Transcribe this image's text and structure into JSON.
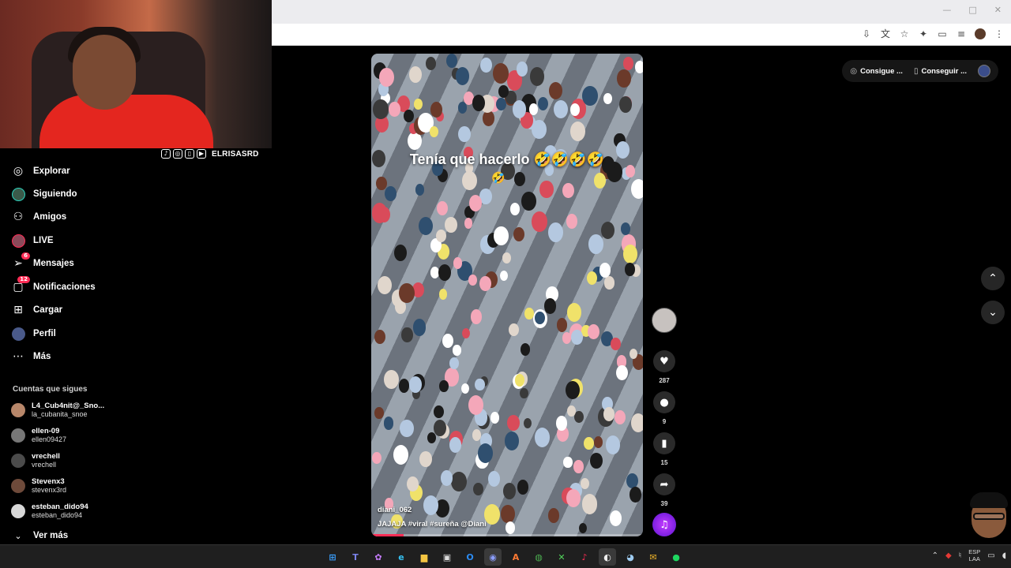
{
  "browser": {
    "window_controls": [
      "—",
      "□",
      "✕"
    ],
    "addr_icons": [
      "download-icon",
      "translate-icon",
      "star-icon",
      "extensions-icon",
      "sidepanel-icon",
      "media-icon",
      "profile-avatar",
      "menu-icon"
    ]
  },
  "webcam": {
    "handle": "ELRISASRD",
    "social_icons": [
      "tiktok-icon",
      "instagram-icon",
      "twitch-icon",
      "youtube-icon"
    ]
  },
  "sidebar": {
    "nav": [
      {
        "label": "Explorar",
        "icon": "compass-icon"
      },
      {
        "label": "Siguiendo",
        "icon": "following-avatar-icon"
      },
      {
        "label": "Amigos",
        "icon": "friends-icon"
      },
      {
        "label": "LIVE",
        "icon": "live-icon"
      },
      {
        "label": "Mensajes",
        "icon": "messages-icon",
        "badge": "6"
      },
      {
        "label": "Notificaciones",
        "icon": "notifications-icon",
        "badge": "12"
      },
      {
        "label": "Cargar",
        "icon": "upload-icon"
      },
      {
        "label": "Perfil",
        "icon": "profile-icon"
      },
      {
        "label": "Más",
        "icon": "more-icon"
      }
    ],
    "following_title": "Cuentas que sigues",
    "accounts": [
      {
        "name": "L4_Cub4nit@_Sno...",
        "user": "la_cubanita_snoe",
        "color": "#b8876a"
      },
      {
        "name": "ellen-09",
        "user": "ellen09427",
        "color": "#777777"
      },
      {
        "name": "vrechell",
        "user": "vrechell",
        "color": "#4b4b4b"
      },
      {
        "name": "Stevenx3",
        "user": "stevenx3rd",
        "color": "#6e4a3a"
      },
      {
        "name": "esteban_dido94",
        "user": "esteban_dido94",
        "color": "#d8d8d8"
      }
    ],
    "see_more": "Ver más"
  },
  "video": {
    "caption": "Tenía que hacerlo 🤣🤣🤣🤣",
    "caption_emoji_extra": "🤣",
    "author": "diani_062",
    "description": "JAJAJA #viral #sureña @Diani",
    "progress": 0.12
  },
  "actions": {
    "like_count": "287",
    "comment_count": "9",
    "save_count": "15",
    "share_count": "39"
  },
  "topright": {
    "pill1": "Consigue ...",
    "pill2": "Conseguir ..."
  },
  "taskbar": {
    "lang_top": "ESP",
    "lang_bottom": "LAA",
    "apps": [
      "windows-start",
      "teams",
      "copilot",
      "edge",
      "file-explorer",
      "store",
      "outlook",
      "discord",
      "office",
      "chrome",
      "xbox",
      "tiktok",
      "obs",
      "steam",
      "mail",
      "spotify"
    ]
  }
}
